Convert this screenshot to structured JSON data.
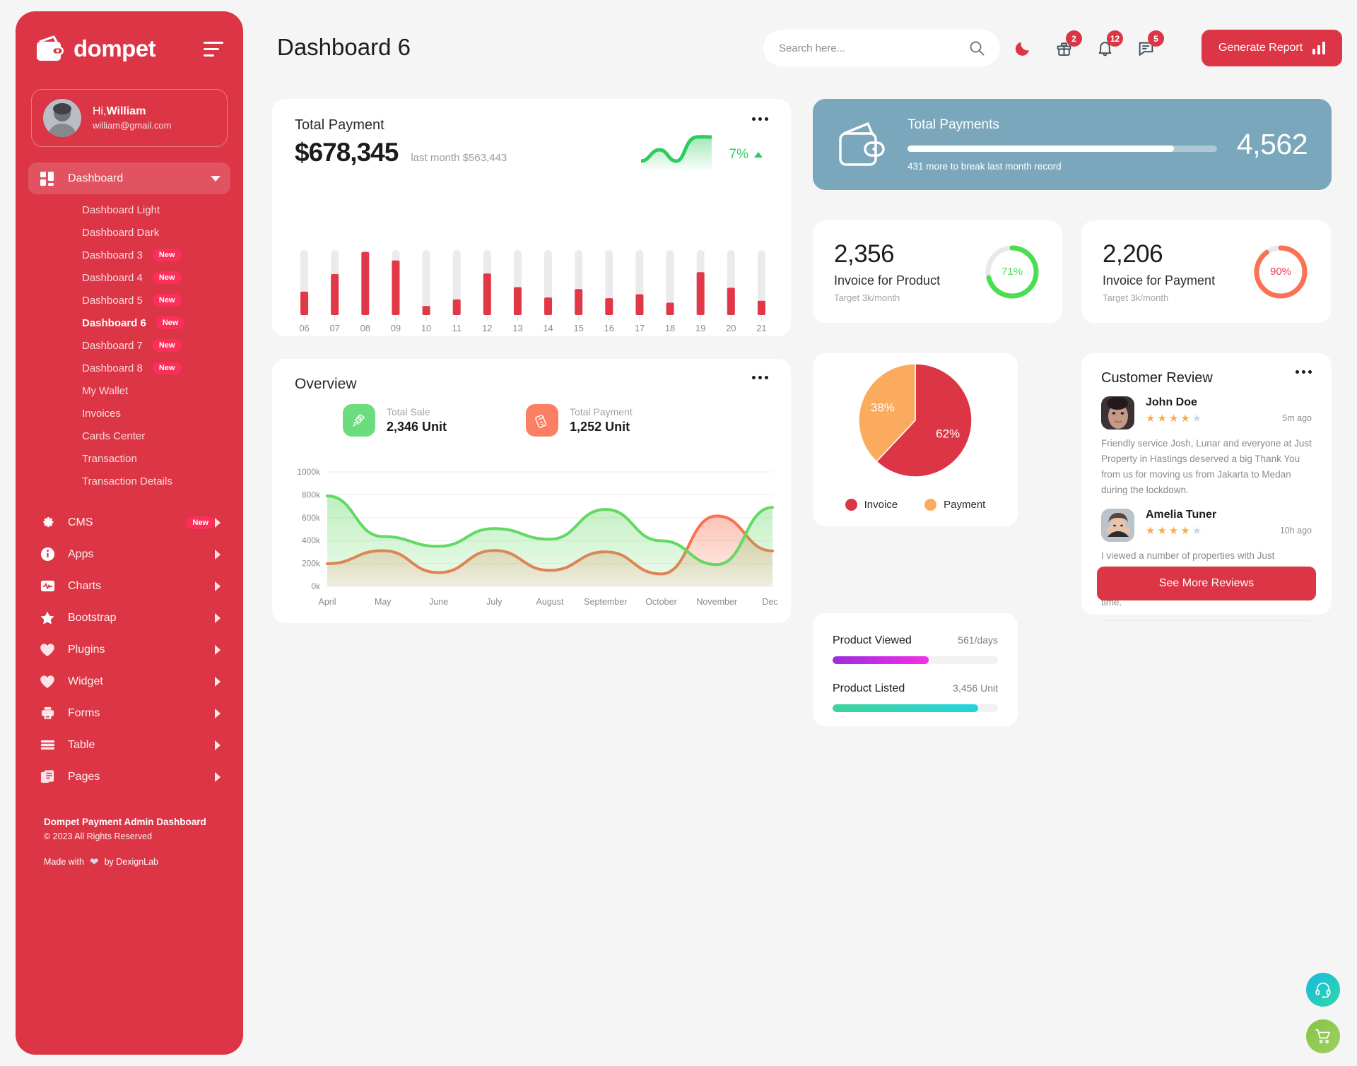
{
  "brand": {
    "name": "dompet",
    "logo_icon": "wallet-icon",
    "menu_toggle_icon": "hamburger-icon"
  },
  "profile": {
    "greeting_prefix": "Hi,",
    "name": "William",
    "email": "william@gmail.com"
  },
  "sidebar": {
    "items": [
      {
        "label": "Dashboard",
        "icon": "grid-icon",
        "active": true,
        "expandable": true
      },
      {
        "label": "CMS",
        "icon": "gear-icon",
        "badge": "New",
        "expandable": true
      },
      {
        "label": "Apps",
        "icon": "info-icon",
        "expandable": true
      },
      {
        "label": "Charts",
        "icon": "chart-pulse-icon",
        "expandable": true
      },
      {
        "label": "Bootstrap",
        "icon": "star-icon",
        "expandable": true
      },
      {
        "label": "Plugins",
        "icon": "heart-icon",
        "expandable": true
      },
      {
        "label": "Widget",
        "icon": "heart-icon",
        "expandable": true
      },
      {
        "label": "Forms",
        "icon": "printer-icon",
        "expandable": true
      },
      {
        "label": "Table",
        "icon": "table-icon",
        "expandable": true
      },
      {
        "label": "Pages",
        "icon": "pages-icon",
        "expandable": true
      }
    ],
    "dashboard_submenu": [
      {
        "label": "Dashboard Light"
      },
      {
        "label": "Dashboard Dark"
      },
      {
        "label": "Dashboard 3",
        "badge": "New"
      },
      {
        "label": "Dashboard 4",
        "badge": "New"
      },
      {
        "label": "Dashboard 5",
        "badge": "New"
      },
      {
        "label": "Dashboard 6",
        "badge": "New",
        "active": true
      },
      {
        "label": "Dashboard 7",
        "badge": "New"
      },
      {
        "label": "Dashboard 8",
        "badge": "New"
      },
      {
        "label": "My Wallet"
      },
      {
        "label": "Invoices"
      },
      {
        "label": "Cards Center"
      },
      {
        "label": "Transaction"
      },
      {
        "label": "Transaction Details"
      }
    ],
    "footer": {
      "title": "Dompet Payment Admin Dashboard",
      "copyright": "© 2023 All Rights Reserved",
      "made_prefix": "Made with",
      "made_suffix": "by DexignLab",
      "heart_icon": "heart-icon"
    }
  },
  "header": {
    "title": "Dashboard 6",
    "search_placeholder": "Search here...",
    "search_value": "",
    "search_icon": "search-icon",
    "icons": [
      {
        "name": "moon-icon",
        "badge": null
      },
      {
        "name": "gift-icon",
        "badge": "2"
      },
      {
        "name": "bell-icon",
        "badge": "12"
      },
      {
        "name": "message-icon",
        "badge": "5"
      }
    ],
    "report_button": {
      "label": "Generate Report",
      "icon": "bar-chart-icon",
      "color": "#dc3545"
    }
  },
  "total_payment": {
    "title": "Total Payment",
    "amount": "$678,345",
    "last_month": "last month $563,443",
    "percent": "7%",
    "trend_icon": "triangle-up-icon",
    "menu_icon": "more-icon"
  },
  "total_payments_banner": {
    "icon": "wallet-icon",
    "title": "Total Payments",
    "subtitle": "431 more to break last month record",
    "value": "4,562",
    "progress_percent": 86,
    "bg_color": "#7ba7bc"
  },
  "invoice_cards": [
    {
      "value": "2,356",
      "label": "Invoice for Product",
      "target": "Target 3k/month",
      "percent": "71%",
      "percent_value": 71,
      "color": "#4ade50"
    },
    {
      "value": "2,206",
      "label": "Invoice for Payment",
      "target": "Target 3k/month",
      "percent": "90%",
      "percent_value": 90,
      "color": "#fa7154"
    }
  ],
  "overview": {
    "title": "Overview",
    "menu_icon": "more-icon",
    "stats": [
      {
        "label": "Total Sale",
        "value": "2,346 Unit",
        "icon": "hand-money-icon",
        "color": "#6cdd7f"
      },
      {
        "label": "Total Payment",
        "value": "1,252 Unit",
        "icon": "card-terminal-icon",
        "color": "#fa7f63"
      }
    ]
  },
  "progress_card": {
    "rows": [
      {
        "label": "Product Viewed",
        "value": "561/days",
        "percent": 58,
        "gradient_from": "#9a2ede",
        "gradient_to": "#f52ee8"
      },
      {
        "label": "Product Listed",
        "value": "3,456 Unit",
        "percent": 88,
        "gradient_from": "#3fd49a",
        "gradient_to": "#23d4e0"
      }
    ]
  },
  "reviews": {
    "title": "Customer Review",
    "menu_icon": "more-icon",
    "see_more_label": "See More Reviews",
    "items": [
      {
        "name": "John Doe",
        "stars": 4,
        "max_stars": 5,
        "ago": "5m ago",
        "text": "Friendly service Josh, Lunar and everyone at Just Property in Hastings deserved a big Thank You from us for moving us from Jakarta to Medan during the lockdown."
      },
      {
        "name": "Amelia Tuner",
        "stars": 4,
        "max_stars": 5,
        "ago": "10h ago",
        "text": "I viewed a number of properties with Just Property and found them to be professional, efficient, patient, courteous and helpful every time."
      }
    ]
  },
  "fabs": [
    {
      "name": "support-headset-fab",
      "icon": "headset-icon"
    },
    {
      "name": "cart-fab",
      "icon": "cart-icon"
    }
  ],
  "chart_data": [
    {
      "type": "bar",
      "name": "total-payment-bars",
      "title": "Total Payment",
      "categories": [
        "06",
        "07",
        "08",
        "09",
        "10",
        "11",
        "12",
        "13",
        "14",
        "15",
        "16",
        "17",
        "18",
        "19",
        "20",
        "21"
      ],
      "values": [
        36,
        63,
        97,
        84,
        14,
        24,
        64,
        43,
        27,
        40,
        26,
        32,
        19,
        66,
        42,
        22
      ],
      "track_max": 100,
      "bar_color": "#e03847",
      "track_color": "#ebebeb",
      "xlabel": "",
      "ylabel": "",
      "ylim": [
        0,
        100
      ],
      "grid": false
    },
    {
      "type": "line",
      "name": "total-payment-sparkline",
      "values": [
        30,
        22,
        48,
        40,
        28,
        45,
        92
      ],
      "color": "#2ecc5f",
      "ylim": [
        0,
        100
      ]
    },
    {
      "type": "area",
      "name": "overview-area",
      "title": "Overview",
      "categories": [
        "April",
        "May",
        "June",
        "July",
        "August",
        "September",
        "October",
        "November",
        "Dec.."
      ],
      "series": [
        {
          "name": "Total Sale",
          "color": "#62d962",
          "values": [
            790,
            435,
            350,
            505,
            412,
            672,
            398,
            190,
            690
          ]
        },
        {
          "name": "Total Payment",
          "color": "#f9714f",
          "values": [
            198,
            312,
            120,
            313,
            140,
            302,
            108,
            615,
            310
          ]
        }
      ],
      "ytick_labels": [
        "0k",
        "200k",
        "400k",
        "600k",
        "800k",
        "1000k"
      ],
      "ylim": [
        0,
        1000
      ],
      "grid": true,
      "legend": "none"
    },
    {
      "type": "pie",
      "name": "invoice-payment-pie",
      "labels": [
        "Invoice",
        "Payment"
      ],
      "values": [
        62,
        38
      ],
      "value_labels": [
        "62%",
        "38%"
      ],
      "colors": [
        "#dc3545",
        "#fbab5e"
      ],
      "legend": "bottom"
    },
    {
      "type": "bar",
      "name": "invoice-product-gauge",
      "labels": [
        "Invoice for Product"
      ],
      "values": [
        71
      ],
      "colors": [
        "#4ade50"
      ]
    },
    {
      "type": "bar",
      "name": "invoice-payment-gauge",
      "labels": [
        "Invoice for Payment"
      ],
      "values": [
        90
      ],
      "colors": [
        "#fa7154"
      ]
    }
  ]
}
